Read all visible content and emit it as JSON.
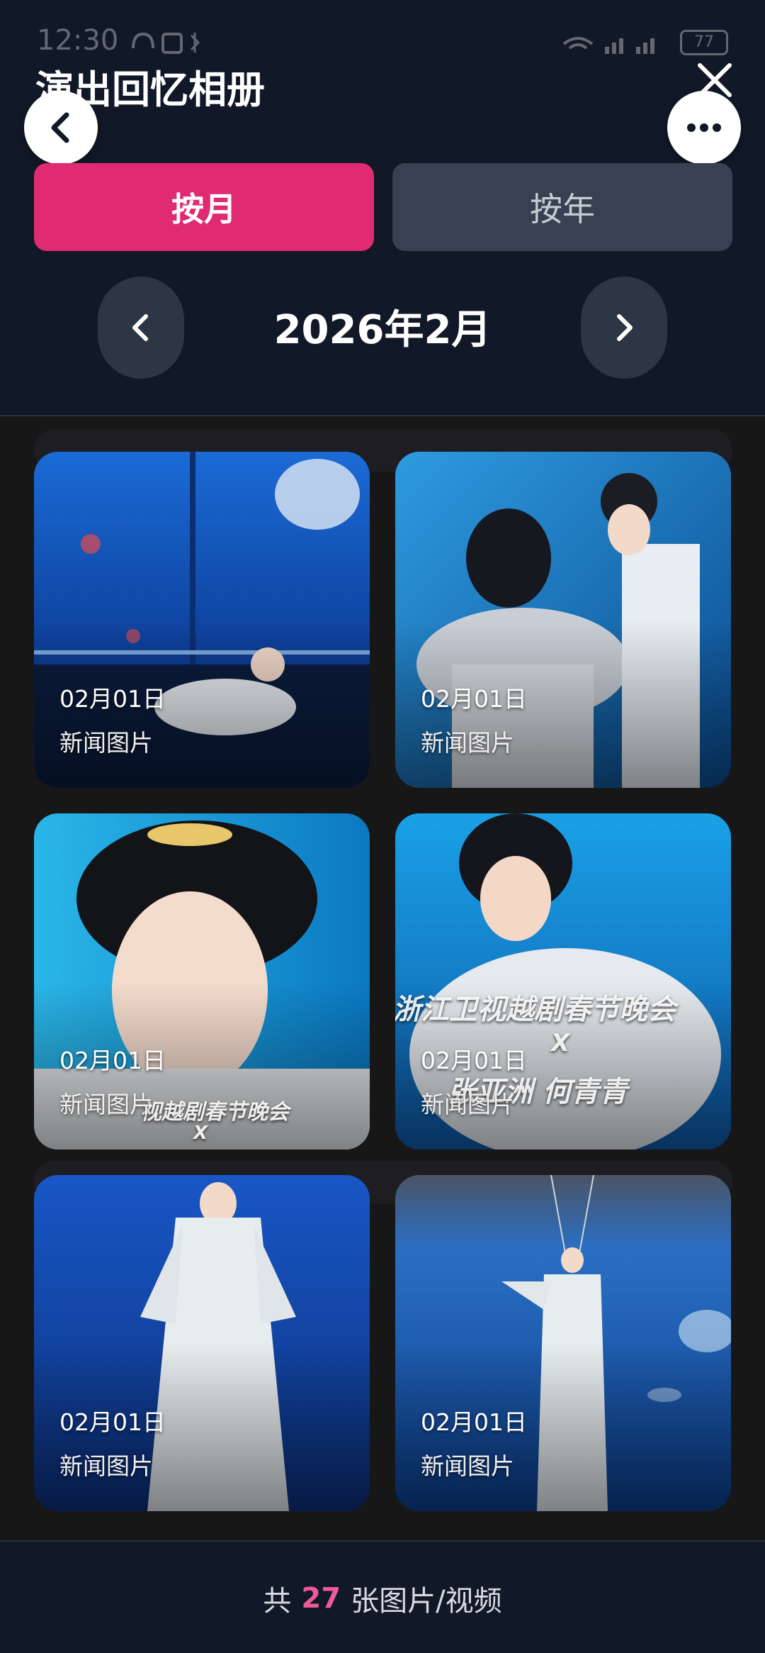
{
  "status_bar": {
    "time": "12:30",
    "battery": "77"
  },
  "header": {
    "title": "演出回忆相册",
    "back_icon": "chevron-left-icon",
    "close_icon": "close-icon",
    "more_icon": "more-horizontal-icon"
  },
  "tabs": [
    {
      "label": "按月",
      "active": true
    },
    {
      "label": "按年",
      "active": false
    }
  ],
  "period": {
    "label": "2026年2月",
    "prev_icon": "chevron-left-icon",
    "next_icon": "chevron-right-icon"
  },
  "photos": [
    {
      "date": "02月01日",
      "label": "新闻图片",
      "scene": "aquarium stage, performer reclining"
    },
    {
      "date": "02月01日",
      "label": "新闻图片",
      "scene": "two performers, fur-collared costume"
    },
    {
      "date": "02月01日",
      "label": "新闻图片",
      "scene": "close-up of performer with headdress",
      "caption": "视越剧春节晚会",
      "caption_x": "X"
    },
    {
      "date": "02月01日",
      "label": "新闻图片",
      "scene": "performer with show caption",
      "caption": "浙江卫视越剧春节晚会",
      "caption_x": "X",
      "caption_names": "张亚洲   何青青"
    },
    {
      "date": "02月01日",
      "label": "新闻图片",
      "scene": "performer in flowing white robes"
    },
    {
      "date": "02月01日",
      "label": "新闻图片",
      "scene": "suspended performer over blue sea"
    }
  ],
  "footer": {
    "prefix": "共",
    "count": "27",
    "suffix": "张图片/视频",
    "count_color": "#f05a9a"
  },
  "colors": {
    "accent": "#e02a72",
    "header_bg": "#111827",
    "tab_inactive": "#374151"
  }
}
